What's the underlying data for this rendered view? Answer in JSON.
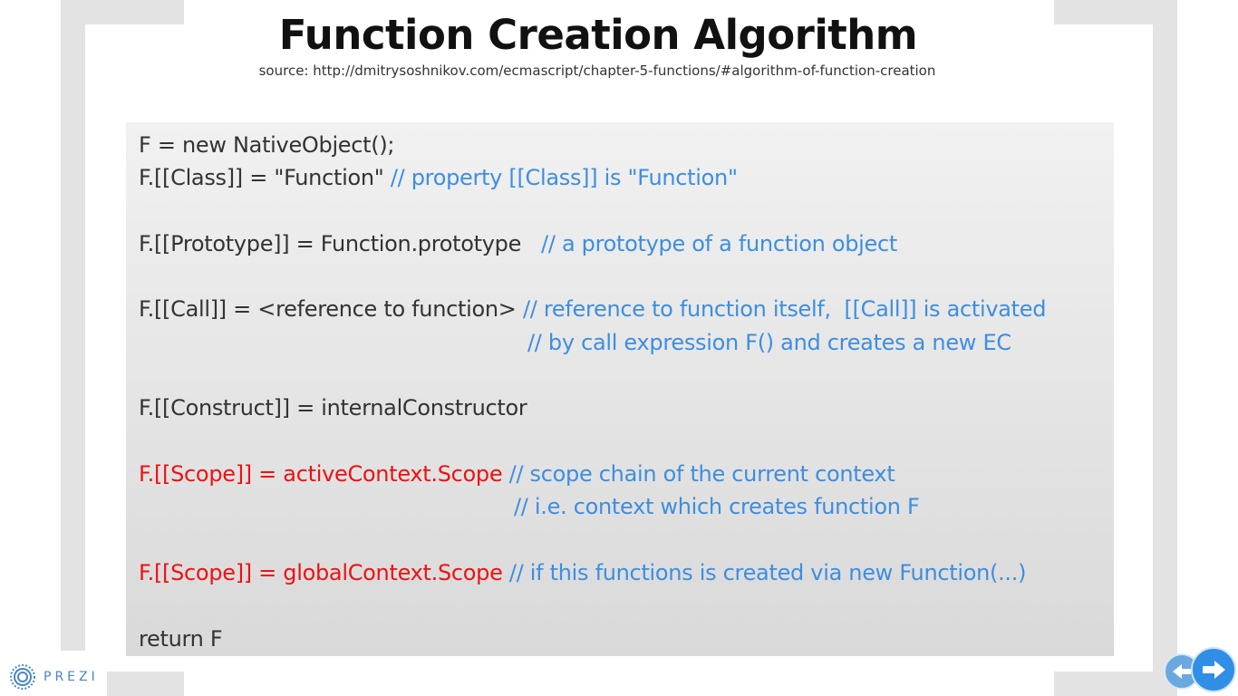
{
  "slide": {
    "title": "Function Creation Algorithm",
    "source": "source: http://dmitrysoshnikov.com/ecmascript/chapter-5-functions/#algorithm-of-function-creation"
  },
  "code": {
    "line1": "F = new NativeObject();",
    "line2_code": "F.[[Class]] = \"Function\" ",
    "line2_comment": "// property [[Class]] is \"Function\"",
    "line3_code": "F.[[Prototype]] = Function.prototype   ",
    "line3_comment": "// a prototype of a function object",
    "line4_code": "F.[[Call]] = <reference to function> ",
    "line4_comment": "// reference to function itself,  [[Call]] is activated",
    "line5_comment": "// by call expression F() and creates a new EC",
    "line6": "F.[[Construct]] = internalConstructor",
    "line7_code": "F.[[Scope]] = activeContext.Scope ",
    "line7_comment": "// scope chain of the current context",
    "line8_comment": "// i.e. context which creates function F",
    "line9_code": "F.[[Scope]] = globalContext.Scope ",
    "line9_comment": "// if this functions is created via new Function(...)",
    "line10": "return F"
  },
  "branding": {
    "logo_text": "PREZI",
    "logo_icon": "prezi-logo-icon"
  },
  "navigation": {
    "prev_icon": "arrow-left-icon",
    "next_icon": "arrow-right-icon"
  },
  "colors": {
    "comment": "#3d8ee0",
    "highlight": "#ee1111",
    "code": "#333333",
    "accent": "#2f8fe6"
  }
}
